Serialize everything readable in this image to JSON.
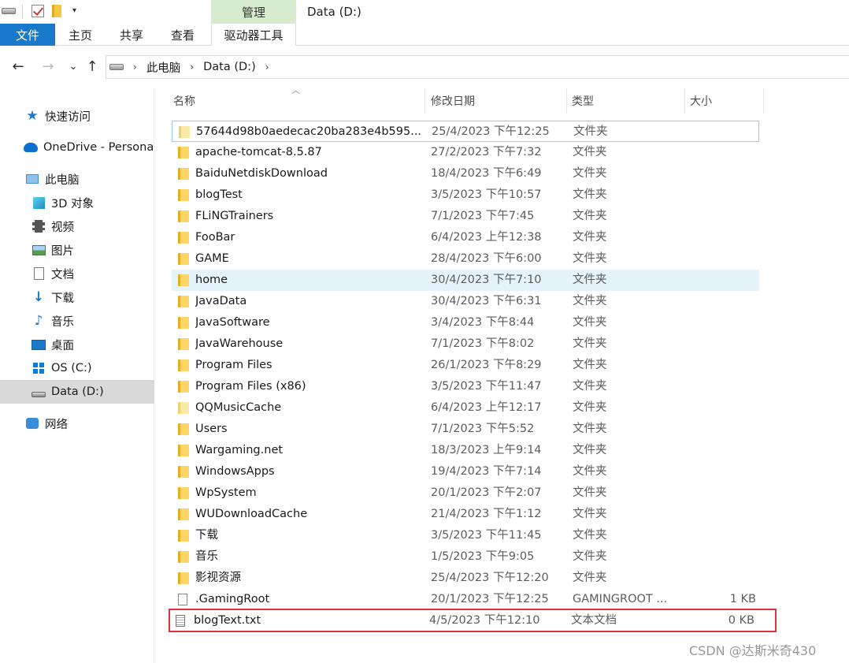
{
  "window": {
    "title": "Data (D:)",
    "manage_tab": "管理"
  },
  "ribbon": {
    "tabs": [
      "文件",
      "主页",
      "共享",
      "查看"
    ],
    "drive_tools": "驱动器工具"
  },
  "address": {
    "crumbs": [
      "此电脑",
      "Data (D:)"
    ],
    "chevron": "›"
  },
  "nav": {
    "back": "←",
    "forward": "→",
    "recent": "⌄",
    "up": "↑"
  },
  "sidebar": {
    "items": [
      {
        "label": "快速访问",
        "icon": "star-icon"
      },
      {
        "label": "OneDrive - Persona",
        "icon": "cloud-icon"
      },
      {
        "label": "此电脑",
        "icon": "computer-icon"
      },
      {
        "label": "3D 对象",
        "icon": "cube-icon"
      },
      {
        "label": "视频",
        "icon": "film-icon"
      },
      {
        "label": "图片",
        "icon": "picture-icon"
      },
      {
        "label": "文档",
        "icon": "document-icon"
      },
      {
        "label": "下载",
        "icon": "download-icon"
      },
      {
        "label": "音乐",
        "icon": "music-icon"
      },
      {
        "label": "桌面",
        "icon": "desktop-icon"
      },
      {
        "label": "OS (C:)",
        "icon": "windows-drive-icon"
      },
      {
        "label": "Data (D:)",
        "icon": "drive-icon",
        "selected": true
      },
      {
        "label": "网络",
        "icon": "network-icon"
      }
    ]
  },
  "columns": {
    "name": "名称",
    "date": "修改日期",
    "type": "类型",
    "size": "大小"
  },
  "files": [
    {
      "name": "57644d98b0aedecac20ba283e4b595...",
      "date": "25/4/2023 下午12:25",
      "type": "文件夹",
      "size": "",
      "kind": "folder-light",
      "state": "focus"
    },
    {
      "name": "apache-tomcat-8.5.87",
      "date": "27/2/2023 下午7:32",
      "type": "文件夹",
      "size": "",
      "kind": "folder"
    },
    {
      "name": "BaiduNetdiskDownload",
      "date": "18/4/2023 下午6:49",
      "type": "文件夹",
      "size": "",
      "kind": "folder"
    },
    {
      "name": "blogTest",
      "date": "3/5/2023 下午10:57",
      "type": "文件夹",
      "size": "",
      "kind": "folder"
    },
    {
      "name": "FLiNGTrainers",
      "date": "7/1/2023 下午7:45",
      "type": "文件夹",
      "size": "",
      "kind": "folder"
    },
    {
      "name": "FooBar",
      "date": "6/4/2023 上午12:38",
      "type": "文件夹",
      "size": "",
      "kind": "folder"
    },
    {
      "name": "GAME",
      "date": "28/4/2023 下午6:00",
      "type": "文件夹",
      "size": "",
      "kind": "folder"
    },
    {
      "name": "home",
      "date": "30/4/2023 下午7:10",
      "type": "文件夹",
      "size": "",
      "kind": "folder",
      "state": "hover"
    },
    {
      "name": "JavaData",
      "date": "30/4/2023 下午6:31",
      "type": "文件夹",
      "size": "",
      "kind": "folder"
    },
    {
      "name": "JavaSoftware",
      "date": "3/4/2023 下午8:44",
      "type": "文件夹",
      "size": "",
      "kind": "folder"
    },
    {
      "name": "JavaWarehouse",
      "date": "7/1/2023 下午8:02",
      "type": "文件夹",
      "size": "",
      "kind": "folder"
    },
    {
      "name": "Program Files",
      "date": "26/1/2023 下午8:29",
      "type": "文件夹",
      "size": "",
      "kind": "folder"
    },
    {
      "name": "Program Files (x86)",
      "date": "3/5/2023 下午11:47",
      "type": "文件夹",
      "size": "",
      "kind": "folder"
    },
    {
      "name": "QQMusicCache",
      "date": "6/4/2023 上午12:17",
      "type": "文件夹",
      "size": "",
      "kind": "folder-light"
    },
    {
      "name": "Users",
      "date": "7/1/2023 下午5:52",
      "type": "文件夹",
      "size": "",
      "kind": "folder"
    },
    {
      "name": "Wargaming.net",
      "date": "18/3/2023 上午9:14",
      "type": "文件夹",
      "size": "",
      "kind": "folder"
    },
    {
      "name": "WindowsApps",
      "date": "19/4/2023 下午7:14",
      "type": "文件夹",
      "size": "",
      "kind": "folder"
    },
    {
      "name": "WpSystem",
      "date": "20/1/2023 下午2:07",
      "type": "文件夹",
      "size": "",
      "kind": "folder"
    },
    {
      "name": "WUDownloadCache",
      "date": "21/4/2023 下午1:12",
      "type": "文件夹",
      "size": "",
      "kind": "folder"
    },
    {
      "name": "下载",
      "date": "3/5/2023 下午11:45",
      "type": "文件夹",
      "size": "",
      "kind": "folder"
    },
    {
      "name": "音乐",
      "date": "1/5/2023 下午9:05",
      "type": "文件夹",
      "size": "",
      "kind": "folder"
    },
    {
      "name": "影视资源",
      "date": "25/4/2023 下午12:20",
      "type": "文件夹",
      "size": "",
      "kind": "folder"
    },
    {
      "name": ".GamingRoot",
      "date": "20/1/2023 下午12:25",
      "type": "GAMINGROOT ...",
      "size": "1 KB",
      "kind": "file"
    },
    {
      "name": "blogText.txt",
      "date": "4/5/2023 下午12:10",
      "type": "文本文档",
      "size": "0 KB",
      "kind": "txt",
      "state": "boxed"
    }
  ],
  "watermark": "CSDN @达斯米奇430",
  "colors": {
    "accent": "#1979ca",
    "manage_tab_bg": "#d7eccf",
    "highlight_box": "#e0323a",
    "hover_row": "#e5f3fb"
  }
}
